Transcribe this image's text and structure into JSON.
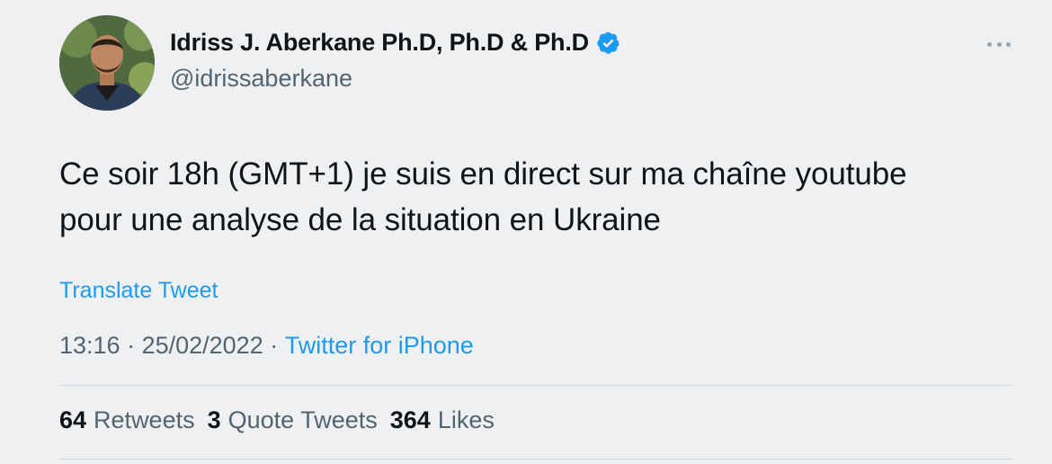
{
  "author": {
    "name": "Idriss J. Aberkane Ph.D, Ph.D & Ph.D",
    "handle": "@idrissaberkane",
    "verified": true,
    "verified_color": "#1d9bf0"
  },
  "tweet": {
    "text": "Ce soir 18h (GMT+1) je suis en direct sur ma chaîne youtube\npour une analyse de la situation en Ukraine",
    "translate_label": "Translate Tweet"
  },
  "meta": {
    "time": "13:16",
    "separator": " · ",
    "date": "25/02/2022",
    "separator2": " · ",
    "source": "Twitter for iPhone"
  },
  "stats": {
    "retweets_count": "64",
    "retweets_label": "Retweets",
    "quotes_count": "3",
    "quotes_label": "Quote Tweets",
    "likes_count": "364",
    "likes_label": "Likes"
  },
  "icons": {
    "more": "more-horizontal-icon",
    "verified": "verified-badge-icon"
  },
  "colors": {
    "background": "#eef0f1",
    "link": "#1d9bf0",
    "text": "#0f1419",
    "muted": "#536471"
  }
}
